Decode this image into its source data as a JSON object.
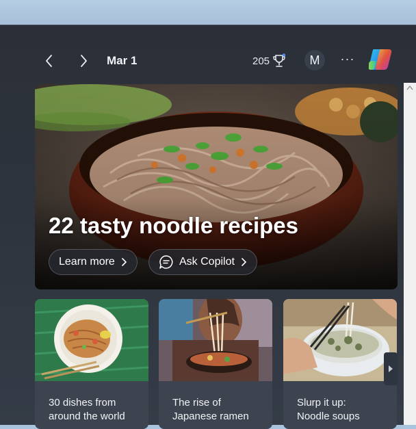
{
  "header": {
    "back_icon": "chevron-left-icon",
    "forward_icon": "chevron-right-icon",
    "date": "Mar 1",
    "points": "205",
    "points_icon": "trophy-icon",
    "avatar_initial": "M",
    "more_label": "···",
    "copilot_icon": "copilot-logo-icon"
  },
  "hero": {
    "title": "22 tasty noodle recipes",
    "learn_more_label": "Learn more",
    "ask_copilot_label": "Ask Copilot"
  },
  "cards": [
    {
      "line1": "30 dishes from",
      "line2": "around the world"
    },
    {
      "line1": "The rise of",
      "line2": "Japanese ramen"
    },
    {
      "line1": "Slurp it up:",
      "line2": "Noodle soups"
    }
  ],
  "colors": {
    "panel_bg": "#2b3038",
    "text": "#f1f3f6",
    "desktop": "#a9c3dc"
  }
}
